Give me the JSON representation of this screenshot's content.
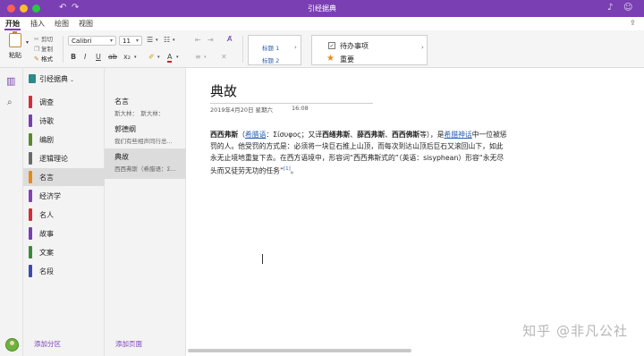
{
  "window": {
    "title": "引经据典",
    "undo_icon": "undo-icon",
    "redo_icon": "redo-icon",
    "bell_icon": "bell-icon",
    "emoji_icon": "smile-icon"
  },
  "ribbon_tabs": [
    "开始",
    "插入",
    "绘图",
    "视图"
  ],
  "clipboard": {
    "paste_label": "粘贴",
    "cut_label": "剪切",
    "copy_label": "复制",
    "format_label": "格式"
  },
  "font": {
    "family_value": "Calibri",
    "size_value": "11"
  },
  "styles": {
    "heading1": "标题 1",
    "heading2": "标题 2"
  },
  "tags": {
    "todo_label": "待办事项",
    "important_label": "重要"
  },
  "notebook": {
    "name": "引经据典",
    "sections": [
      {
        "label": "调查",
        "color": "#d0303a"
      },
      {
        "label": "诗歌",
        "color": "#7a3fb3"
      },
      {
        "label": "编剧",
        "color": "#5a8a2a"
      },
      {
        "label": "逻辑理论",
        "color": "#6a6a6a"
      },
      {
        "label": "名言",
        "color": "#e58a1a"
      },
      {
        "label": "经济学",
        "color": "#8a3fb3"
      },
      {
        "label": "名人",
        "color": "#d0303a"
      },
      {
        "label": "故事",
        "color": "#7a3fb3"
      },
      {
        "label": "文案",
        "color": "#3a8a3a"
      },
      {
        "label": "名段",
        "color": "#3b4bb0"
      }
    ],
    "selected_section": "名言",
    "add_section_label": "添加分区"
  },
  "pages": {
    "items": [
      {
        "title": "名言",
        "preview": "斯大林：　斯大林："
      },
      {
        "title": "郭德纲",
        "preview": "我们有些相声同行总..."
      },
      {
        "title": "典故",
        "preview": "西西弗斯（希腊语：Σ..."
      }
    ],
    "selected_page": "典故",
    "add_page_label": "添加页面"
  },
  "note": {
    "title": "典故",
    "date": "2019年4月20日 星期六",
    "time": "16:08",
    "body": {
      "name": "西西弗斯",
      "paren_open": "（",
      "lang_link": "希腊语",
      "greek": "：Σίσυφος；又译",
      "alt1": "西绪弗斯",
      "sep1": "、",
      "alt2": "薛西弗斯",
      "sep2": "、",
      "alt3": "西西佛斯",
      "tail1": "等），是",
      "myth_link": "希腊神话",
      "tail2": "中一位被惩罚的人。他受罚的方式是：必须将一块巨石推上山顶，而每次到达山顶后巨石又滚回山下，如此永无止境地重复下去。在西方语境中，形容词“西西弗斯式的”（英语：sisyphean）形容“永无尽头而又徒劳无功的任务”",
      "ref": "[1]",
      "end": "。"
    }
  },
  "watermark": "知乎 @非凡公社"
}
